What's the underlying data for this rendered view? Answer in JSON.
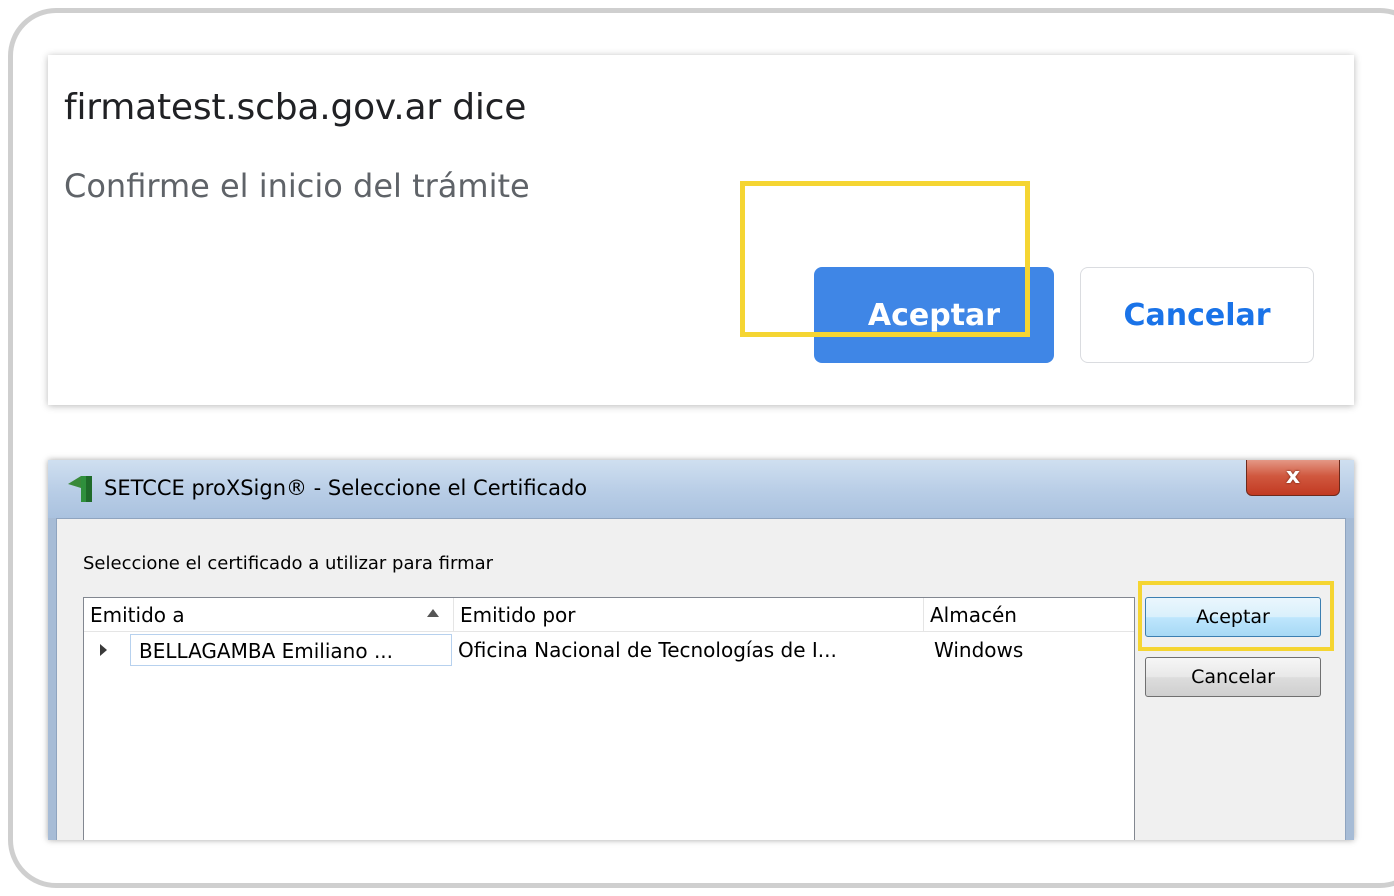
{
  "browser_dialog": {
    "title": "firmatest.scba.gov.ar dice",
    "message": "Confirme el inicio del trámite",
    "accept_label": "Aceptar",
    "cancel_label": "Cancelar"
  },
  "cert_dialog": {
    "title": "SETCCE proXSign® - Seleccione el Certificado",
    "close_label": "x",
    "instruction": "Seleccione el certificado a utilizar para firmar",
    "columns": [
      "Emitido a",
      "Emitido por",
      "Almacén"
    ],
    "rows": [
      {
        "issued_to": "BELLAGAMBA Emiliano ...",
        "issued_by": "Oficina Nacional de Tecnologías de I...",
        "store": "Windows"
      }
    ],
    "accept_label": "Aceptar",
    "cancel_label": "Cancelar"
  },
  "colors": {
    "highlight": "#f5d532",
    "chrome_blue_button": "#3f86e6",
    "chrome_link_blue": "#1a73e8"
  }
}
